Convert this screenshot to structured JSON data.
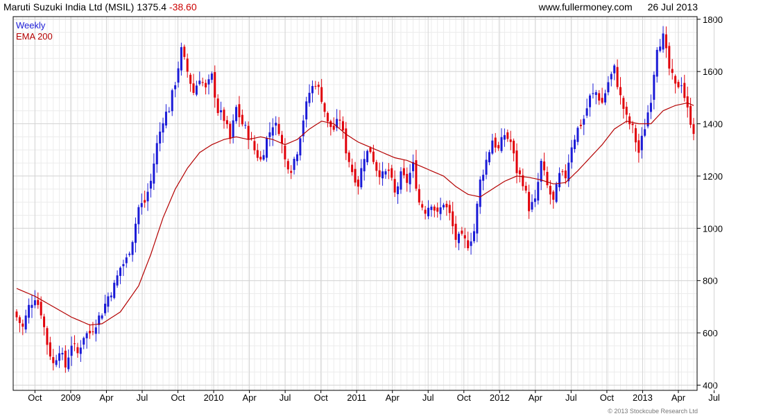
{
  "header": {
    "instrument": "Maruti Suzuki India Ltd (MSIL)",
    "price": "1375.4",
    "change": "-38.60",
    "site": "www.fullermoney.com",
    "date": "26 Jul 2013"
  },
  "legend": {
    "frequency": "Weekly",
    "indicator": "EMA 200"
  },
  "copyright": "© 2013 Stockcube Research Ltd",
  "colors": {
    "up": "#1a1ad6",
    "down": "#e0000a",
    "ema": "#b40000",
    "grid": "#d4d4d4"
  },
  "chart_data": {
    "type": "candlestick",
    "frequency": "weekly",
    "ylim": [
      380,
      1810
    ],
    "yticks": [
      400,
      600,
      800,
      1000,
      1200,
      1400,
      1600,
      1800
    ],
    "grid": true,
    "x_tick_labels": [
      "Oct",
      "2009",
      "Apr",
      "Jul",
      "Oct",
      "2010",
      "Apr",
      "Jul",
      "Oct",
      "2011",
      "Apr",
      "Jul",
      "Oct",
      "2012",
      "Apr",
      "Jul",
      "Oct",
      "2013",
      "Apr",
      "Jul"
    ],
    "close_path": [
      [
        0,
        660
      ],
      [
        2,
        620
      ],
      [
        4,
        700
      ],
      [
        6,
        740
      ],
      [
        8,
        680
      ],
      [
        10,
        560
      ],
      [
        12,
        480
      ],
      [
        14,
        540
      ],
      [
        16,
        470
      ],
      [
        18,
        560
      ],
      [
        20,
        520
      ],
      [
        22,
        590
      ],
      [
        24,
        600
      ],
      [
        26,
        640
      ],
      [
        28,
        680
      ],
      [
        30,
        740
      ],
      [
        32,
        780
      ],
      [
        34,
        850
      ],
      [
        36,
        880
      ],
      [
        38,
        960
      ],
      [
        40,
        1080
      ],
      [
        42,
        1100
      ],
      [
        44,
        1180
      ],
      [
        46,
        1320
      ],
      [
        48,
        1420
      ],
      [
        50,
        1460
      ],
      [
        52,
        1560
      ],
      [
        54,
        1680
      ],
      [
        56,
        1600
      ],
      [
        58,
        1520
      ],
      [
        60,
        1580
      ],
      [
        62,
        1530
      ],
      [
        64,
        1580
      ],
      [
        66,
        1450
      ],
      [
        68,
        1420
      ],
      [
        70,
        1340
      ],
      [
        72,
        1460
      ],
      [
        74,
        1400
      ],
      [
        76,
        1360
      ],
      [
        78,
        1300
      ],
      [
        80,
        1260
      ],
      [
        82,
        1340
      ],
      [
        84,
        1400
      ],
      [
        86,
        1380
      ],
      [
        88,
        1260
      ],
      [
        90,
        1230
      ],
      [
        92,
        1300
      ],
      [
        94,
        1420
      ],
      [
        96,
        1520
      ],
      [
        98,
        1560
      ],
      [
        100,
        1500
      ],
      [
        102,
        1400
      ],
      [
        104,
        1380
      ],
      [
        106,
        1420
      ],
      [
        108,
        1300
      ],
      [
        110,
        1220
      ],
      [
        112,
        1170
      ],
      [
        114,
        1280
      ],
      [
        116,
        1300
      ],
      [
        118,
        1230
      ],
      [
        120,
        1200
      ],
      [
        122,
        1220
      ],
      [
        124,
        1130
      ],
      [
        126,
        1200
      ],
      [
        128,
        1180
      ],
      [
        130,
        1240
      ],
      [
        132,
        1100
      ],
      [
        134,
        1070
      ],
      [
        136,
        1100
      ],
      [
        138,
        1050
      ],
      [
        140,
        1100
      ],
      [
        142,
        1050
      ],
      [
        144,
        960
      ],
      [
        146,
        960
      ],
      [
        148,
        940
      ],
      [
        150,
        990
      ],
      [
        152,
        1180
      ],
      [
        154,
        1260
      ],
      [
        156,
        1340
      ],
      [
        158,
        1300
      ],
      [
        160,
        1360
      ],
      [
        162,
        1330
      ],
      [
        164,
        1220
      ],
      [
        166,
        1180
      ],
      [
        168,
        1080
      ],
      [
        170,
        1100
      ],
      [
        172,
        1250
      ],
      [
        174,
        1160
      ],
      [
        176,
        1100
      ],
      [
        178,
        1200
      ],
      [
        180,
        1200
      ],
      [
        182,
        1320
      ],
      [
        184,
        1380
      ],
      [
        186,
        1420
      ],
      [
        188,
        1500
      ],
      [
        190,
        1520
      ],
      [
        192,
        1480
      ],
      [
        194,
        1560
      ],
      [
        196,
        1610
      ],
      [
        198,
        1500
      ],
      [
        200,
        1420
      ],
      [
        202,
        1380
      ],
      [
        204,
        1290
      ],
      [
        206,
        1390
      ],
      [
        208,
        1500
      ],
      [
        210,
        1700
      ],
      [
        212,
        1730
      ],
      [
        214,
        1610
      ],
      [
        216,
        1540
      ],
      [
        218,
        1560
      ],
      [
        220,
        1450
      ],
      [
        222,
        1375.4
      ]
    ],
    "ema_200": [
      [
        0,
        770
      ],
      [
        6,
        740
      ],
      [
        12,
        700
      ],
      [
        18,
        660
      ],
      [
        24,
        630
      ],
      [
        28,
        635
      ],
      [
        34,
        680
      ],
      [
        40,
        780
      ],
      [
        44,
        900
      ],
      [
        48,
        1040
      ],
      [
        52,
        1150
      ],
      [
        56,
        1230
      ],
      [
        60,
        1290
      ],
      [
        64,
        1320
      ],
      [
        68,
        1340
      ],
      [
        72,
        1350
      ],
      [
        76,
        1340
      ],
      [
        80,
        1350
      ],
      [
        84,
        1340
      ],
      [
        88,
        1320
      ],
      [
        92,
        1340
      ],
      [
        96,
        1380
      ],
      [
        100,
        1410
      ],
      [
        104,
        1400
      ],
      [
        108,
        1360
      ],
      [
        112,
        1330
      ],
      [
        116,
        1310
      ],
      [
        120,
        1290
      ],
      [
        124,
        1270
      ],
      [
        128,
        1260
      ],
      [
        132,
        1240
      ],
      [
        136,
        1220
      ],
      [
        140,
        1200
      ],
      [
        144,
        1160
      ],
      [
        148,
        1130
      ],
      [
        152,
        1120
      ],
      [
        156,
        1150
      ],
      [
        160,
        1180
      ],
      [
        164,
        1200
      ],
      [
        168,
        1195
      ],
      [
        172,
        1185
      ],
      [
        176,
        1170
      ],
      [
        180,
        1175
      ],
      [
        184,
        1220
      ],
      [
        188,
        1270
      ],
      [
        192,
        1320
      ],
      [
        196,
        1380
      ],
      [
        200,
        1410
      ],
      [
        204,
        1400
      ],
      [
        208,
        1400
      ],
      [
        212,
        1450
      ],
      [
        216,
        1470
      ],
      [
        220,
        1480
      ],
      [
        222,
        1470
      ]
    ],
    "weeks": 223
  }
}
